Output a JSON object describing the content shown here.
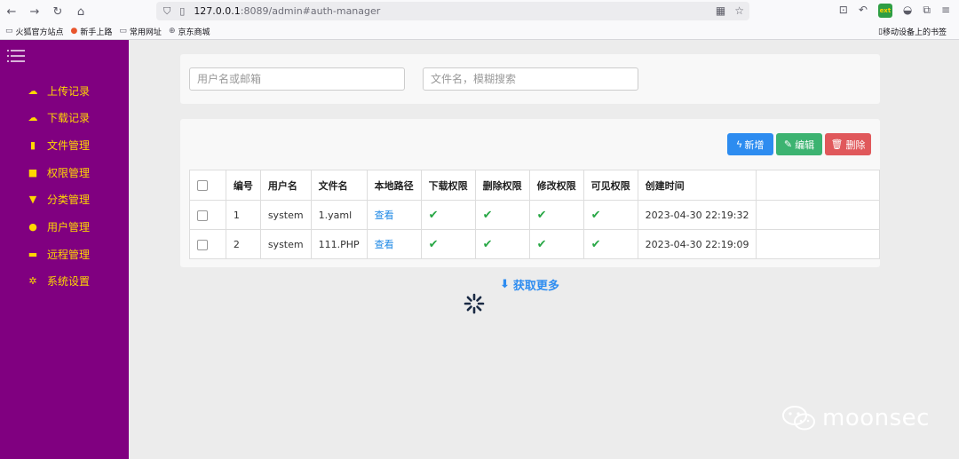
{
  "browser": {
    "url_host": "127.0.0.1",
    "url_rest": ":8089/admin#auth-manager",
    "bookmarks": [
      "火狐官方站点",
      "新手上路",
      "常用网址",
      "京东商城"
    ],
    "mobile_bookmarks": "移动设备上的书签"
  },
  "sidebar": {
    "items": [
      {
        "label": "上传记录",
        "icon": "cloud-upload-icon"
      },
      {
        "label": "下载记录",
        "icon": "cloud-download-icon"
      },
      {
        "label": "文件管理",
        "icon": "file-icon"
      },
      {
        "label": "权限管理",
        "icon": "lock-icon"
      },
      {
        "label": "分类管理",
        "icon": "filter-icon"
      },
      {
        "label": "用户管理",
        "icon": "user-icon"
      },
      {
        "label": "远程管理",
        "icon": "folder-icon"
      },
      {
        "label": "系统设置",
        "icon": "gear-icon"
      }
    ]
  },
  "search": {
    "user_placeholder": "用户名或邮箱",
    "file_placeholder": "文件名，模糊搜索"
  },
  "actions": {
    "add": "新增",
    "edit": "编辑",
    "delete": "删除"
  },
  "table": {
    "headers": [
      "编号",
      "用户名",
      "文件名",
      "本地路径",
      "下载权限",
      "删除权限",
      "修改权限",
      "可见权限",
      "创建时间"
    ],
    "rows": [
      {
        "id": "1",
        "user": "system",
        "file": "1.yaml",
        "path": "查看",
        "download": true,
        "delete": true,
        "modify": true,
        "visible": true,
        "created": "2023-04-30 22:19:32"
      },
      {
        "id": "2",
        "user": "system",
        "file": "111.PHP",
        "path": "查看",
        "download": true,
        "delete": true,
        "modify": true,
        "visible": true,
        "created": "2023-04-30 22:19:09"
      }
    ]
  },
  "load_more": "获取更多",
  "watermark": "moonsec",
  "colors": {
    "sidebar_bg": "#800080",
    "sidebar_text": "#ffd700",
    "primary": "#2d8cf0",
    "success": "#3cb371",
    "danger": "#e0585b",
    "check": "#28a745"
  }
}
